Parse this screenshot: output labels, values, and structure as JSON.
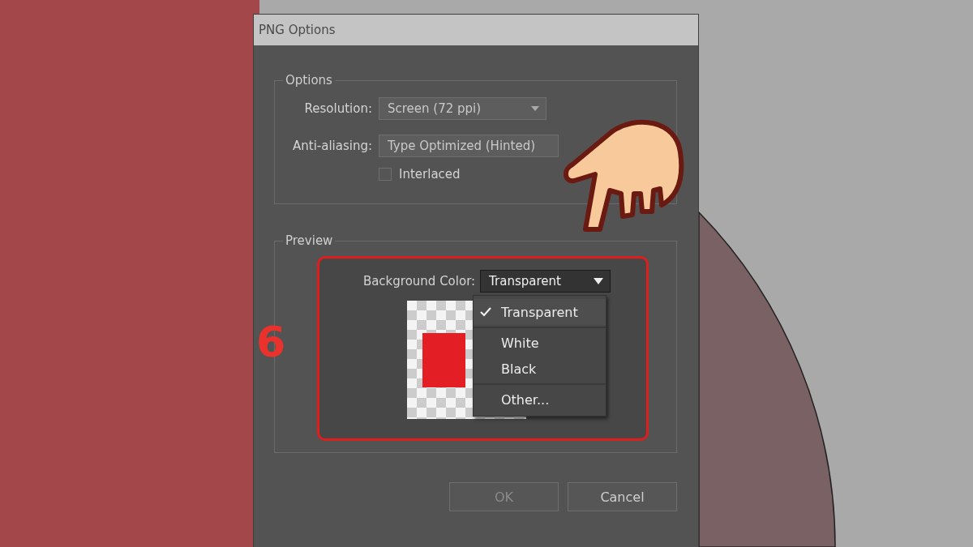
{
  "window": {
    "title": "PNG Options"
  },
  "options": {
    "title": "Options",
    "resolution": {
      "label": "Resolution:",
      "value": "Screen (72 ppi)"
    },
    "anti_aliasing": {
      "label": "Anti-aliasing:",
      "value": "Type Optimized (Hinted)"
    },
    "interlaced": {
      "label": "Interlaced",
      "checked": false
    }
  },
  "preview": {
    "title": "Preview",
    "background_color": {
      "label": "Background Color:",
      "value": "Transparent",
      "expanded": true,
      "option_groups": [
        [
          {
            "label": "Transparent",
            "selected": true
          }
        ],
        [
          {
            "label": "White",
            "selected": false
          },
          {
            "label": "Black",
            "selected": false
          }
        ],
        [
          {
            "label": "Other...",
            "selected": false
          }
        ]
      ]
    }
  },
  "buttons": [
    {
      "label": "OK",
      "disabled": true
    },
    {
      "label": "Cancel",
      "disabled": false
    }
  ],
  "annotation": {
    "step": "6"
  }
}
